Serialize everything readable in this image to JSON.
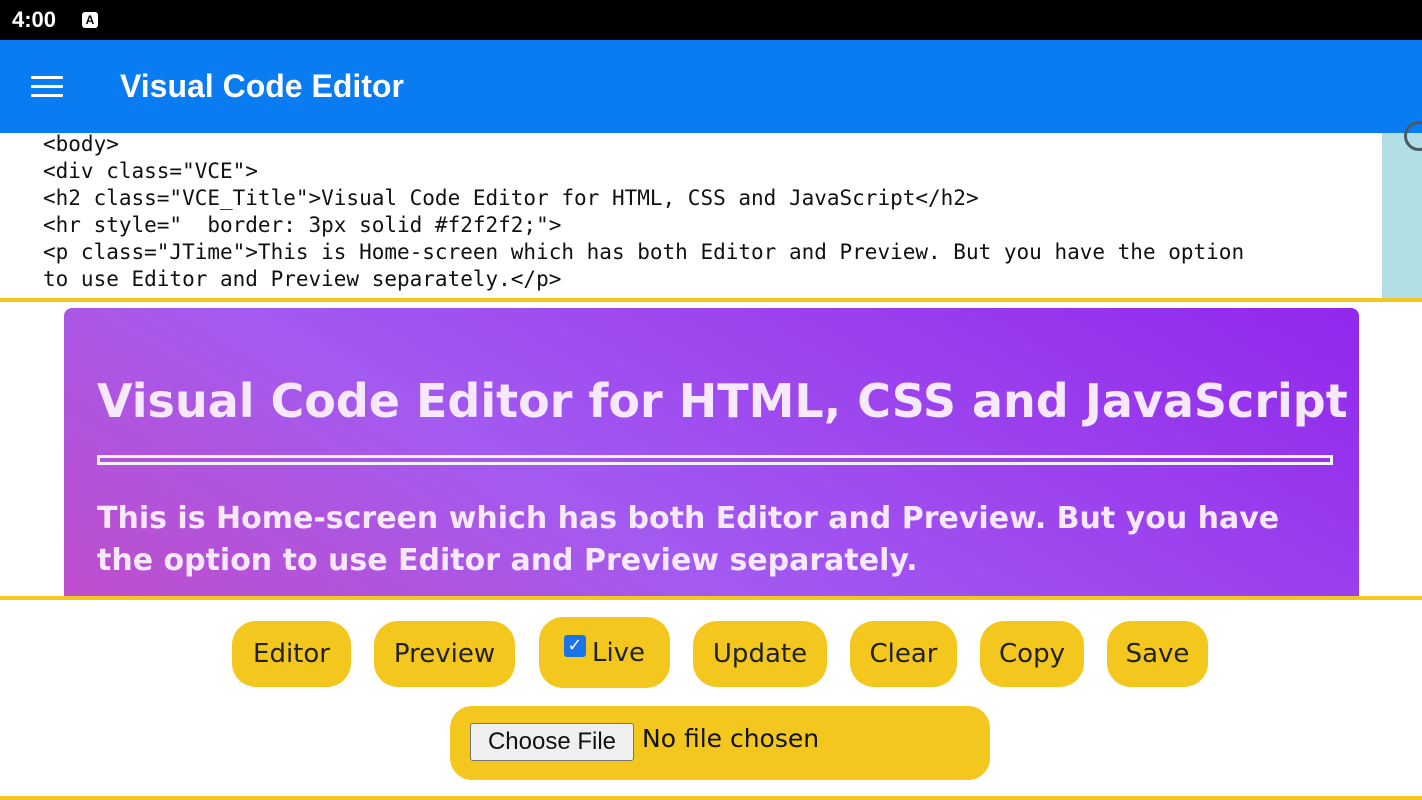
{
  "status_bar": {
    "time": "4:00",
    "notification_icon": "A"
  },
  "app_bar": {
    "title": "Visual Code Editor",
    "menu_icon": "menu-icon"
  },
  "editor": {
    "lines": [
      "<body>",
      "<div class=\"VCE\">",
      "<h2 class=\"VCE_Title\">Visual Code Editor for HTML, CSS and JavaScript</h2>",
      "<hr style=\"  border: 3px solid #f2f2f2;\">",
      "<p class=\"JTime\">This is Home-screen which has both Editor and Preview. But you have the option",
      "to use Editor and Preview separately.</p>"
    ]
  },
  "preview": {
    "title": "Visual Code Editor for HTML, CSS and JavaScript",
    "paragraph": "This is Home-screen which has both Editor and Preview. But you have the option to use Editor and Preview separately."
  },
  "toolbar": {
    "editor_label": "Editor",
    "preview_label": "Preview",
    "live_label": "Live",
    "live_checked": true,
    "update_label": "Update",
    "clear_label": "Clear",
    "copy_label": "Copy",
    "save_label": "Save",
    "choose_file_label": "Choose File",
    "file_status": "No file chosen"
  },
  "colors": {
    "app_bar": "#0a7cf2",
    "accent": "#f4c71e",
    "preview_gradient_start": "#c04ec9",
    "preview_gradient_end": "#9227ec"
  }
}
